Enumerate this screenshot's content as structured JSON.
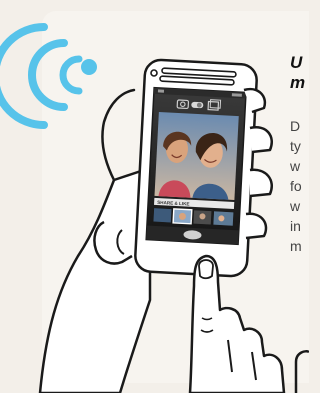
{
  "headline": {
    "lines": [
      "U",
      "m"
    ]
  },
  "body": {
    "lines": [
      "D",
      "ty",
      "w",
      "fo",
      "w",
      "in",
      "m"
    ]
  },
  "phone": {
    "image_caption": "SHARE & LIKE",
    "selected_thumbnail": 1
  },
  "icons": {
    "wireless": "wifi-signal-icon",
    "camera": "camera-icon",
    "gallery": "gallery-icon"
  },
  "colors": {
    "background": "#f3efe9",
    "card": "#f7f4ef",
    "wifi_blue": "#57c3ea",
    "outline": "#1a1a1a",
    "phone_screen": "#1e1e1e"
  }
}
